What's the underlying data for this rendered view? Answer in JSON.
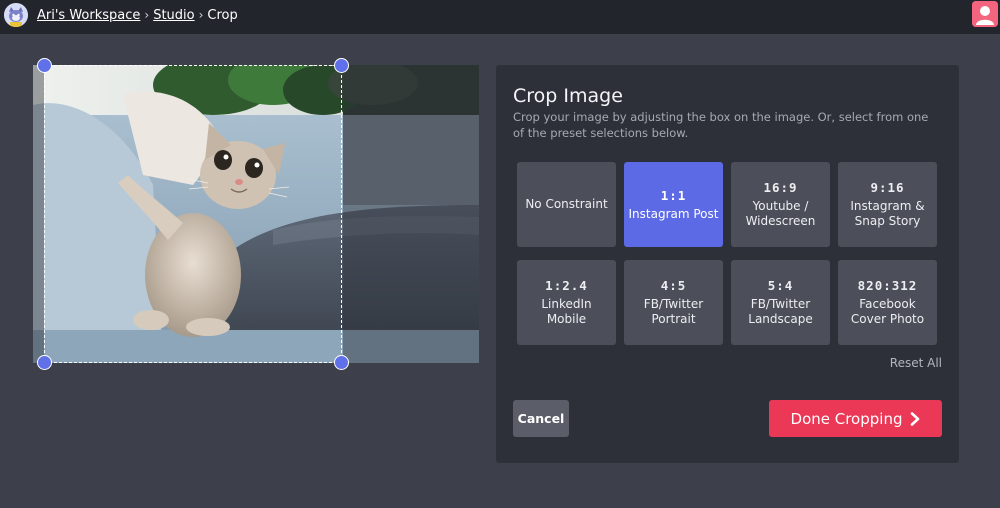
{
  "header": {
    "breadcrumbs": [
      {
        "label": "Ari's Workspace"
      },
      {
        "label": "Studio"
      }
    ],
    "current": "Crop",
    "separator": "›"
  },
  "editor": {
    "image": "cat-on-sofa",
    "crop_ratio": "1:1"
  },
  "panel": {
    "title": "Crop Image",
    "description": "Crop your image by adjusting the box on the image. Or, select from one of the preset selections below.",
    "presets": [
      {
        "ratio": "",
        "name": "No Constraint"
      },
      {
        "ratio": "1:1",
        "name": "Instagram Post",
        "selected": true
      },
      {
        "ratio": "16:9",
        "name": "Youtube / Widescreen"
      },
      {
        "ratio": "9:16",
        "name": "Instagram & Snap Story"
      },
      {
        "ratio": "1:2.4",
        "name": "LinkedIn Mobile"
      },
      {
        "ratio": "4:5",
        "name": "FB/Twitter Portrait"
      },
      {
        "ratio": "5:4",
        "name": "FB/Twitter Landscape"
      },
      {
        "ratio": "820:312",
        "name": "Facebook Cover Photo"
      }
    ],
    "reset_label": "Reset All",
    "cancel_label": "Cancel",
    "done_label": "Done Cropping",
    "done_icon": "chevron-right-icon"
  },
  "colors": {
    "accent": "#5d6ae6",
    "primary_button": "#ea3856",
    "background": "#3d404a",
    "panel": "#2d3038"
  }
}
